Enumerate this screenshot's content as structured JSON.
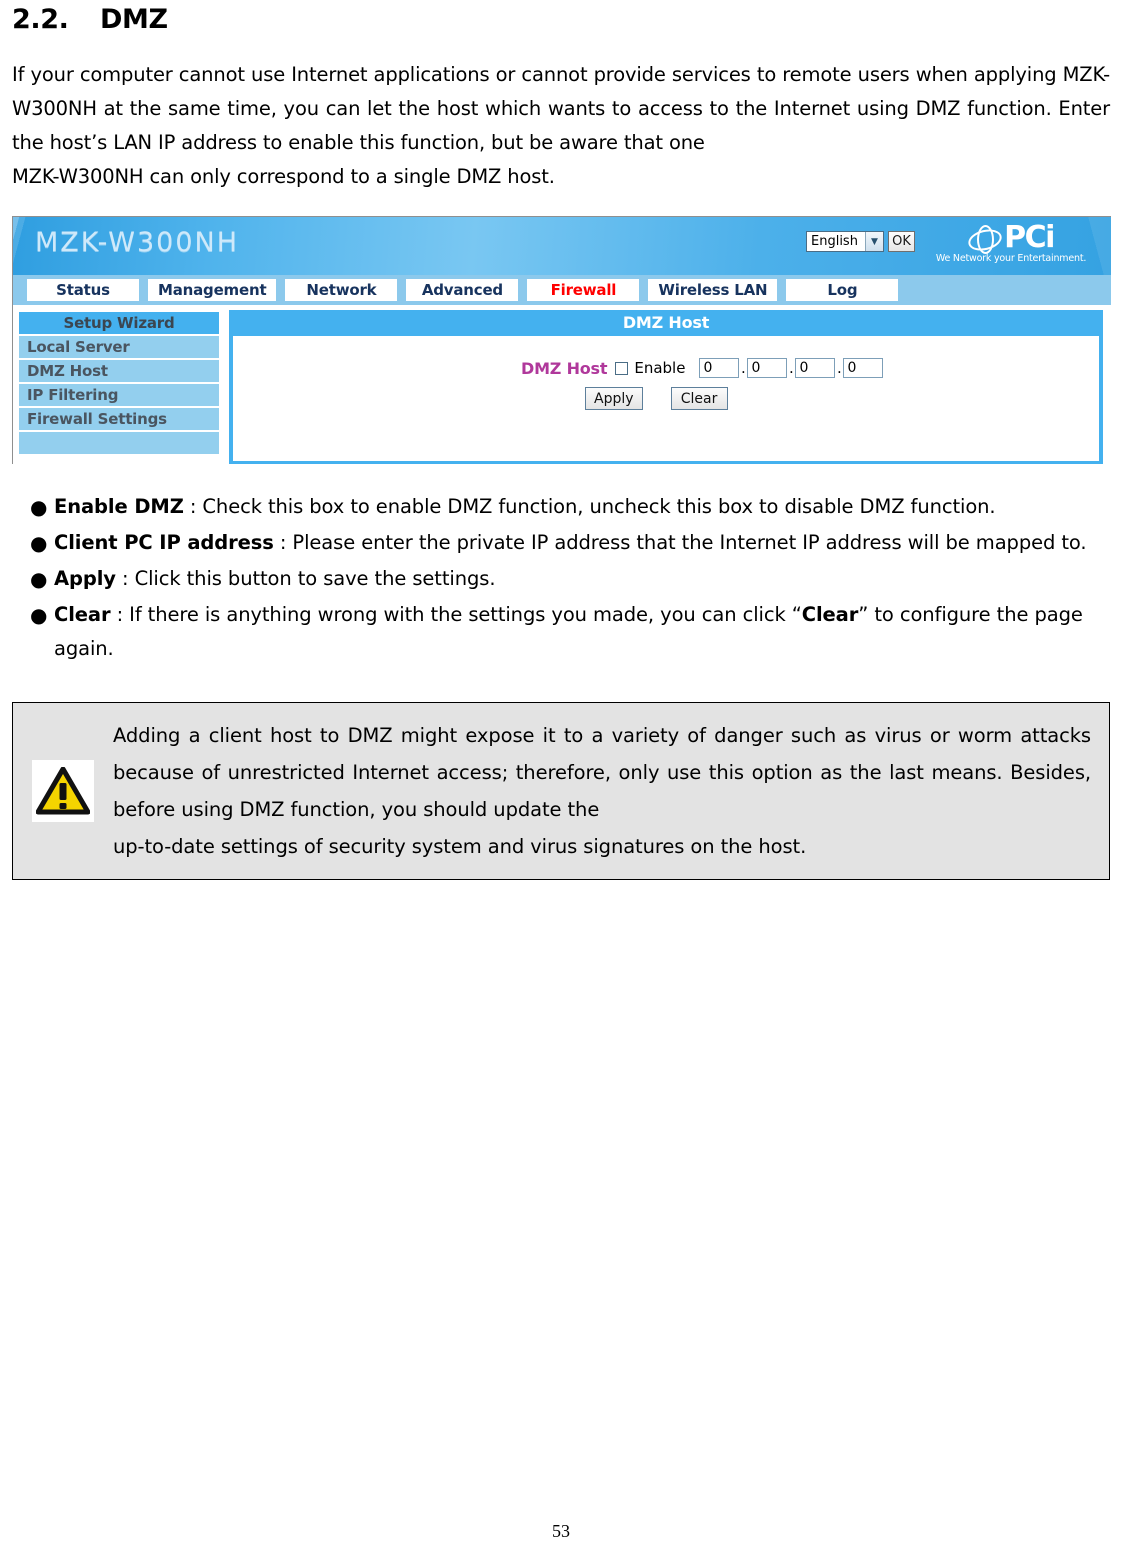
{
  "heading": {
    "number": "2.2.",
    "title": "DMZ"
  },
  "intro": {
    "line1": "If your computer cannot use Internet applications or cannot provide services to remote users when applying MZK-W300NH at the same time, you can let the host which wants to access to the Internet using DMZ function. Enter the host’s LAN IP address to enable this function, but be aware that one",
    "line2": "MZK-W300NH can only correspond to a single DMZ host."
  },
  "router_ui": {
    "model_name": "MZK-W300NH",
    "language": {
      "selected": "English",
      "arrow_icon": "chevron-down-icon",
      "ok_label": "OK"
    },
    "brand": {
      "mark_icon": "pci-globe-icon",
      "name": "PCi",
      "tagline": "We Network your Entertainment."
    },
    "nav_tabs": [
      {
        "label": "Status",
        "active": false
      },
      {
        "label": "Management",
        "active": false
      },
      {
        "label": "Network",
        "active": false
      },
      {
        "label": "Advanced",
        "active": false
      },
      {
        "label": "Firewall",
        "active": true
      },
      {
        "label": "Wireless LAN",
        "active": false
      },
      {
        "label": "Log",
        "active": false
      }
    ],
    "sidebar": [
      {
        "label": "Setup Wizard",
        "selected": true
      },
      {
        "label": "Local Server",
        "selected": false
      },
      {
        "label": "DMZ Host",
        "selected": false
      },
      {
        "label": "IP Filtering",
        "selected": false
      },
      {
        "label": "Firewall Settings",
        "selected": false
      }
    ],
    "panel": {
      "title": "DMZ Host",
      "field_label": "DMZ Host",
      "checkbox": {
        "label": "Enable",
        "checked": false
      },
      "ip_octets": [
        "0",
        "0",
        "0",
        "0"
      ],
      "separator": ".",
      "buttons": [
        {
          "label": "Apply"
        },
        {
          "label": "Clear"
        }
      ]
    }
  },
  "bullets": [
    {
      "marker": "●",
      "term": "Enable DMZ",
      "rest": " : Check this box to enable DMZ function, uncheck this box to disable DMZ function."
    },
    {
      "marker": "●",
      "term": "Client PC IP address",
      "rest": " : Please enter the private IP address that the Internet IP address will be mapped to."
    },
    {
      "marker": "●",
      "term": "Apply",
      "rest": " : Click this button to save the settings."
    },
    {
      "marker": "●",
      "term": "Clear",
      "rest_before": " : If there is anything wrong with the settings you made, you can click “",
      "emphasis": "Clear",
      "rest_after": "” to configure the page again."
    }
  ],
  "note": {
    "icon": "warning-triangle-icon",
    "body": "Adding a client host to DMZ might expose it to a variety of danger such as virus or worm attacks because of unrestricted Internet access; therefore, only use this option as the last means. Besides, before using DMZ function, you should update the",
    "body_last": "up-to-date settings of security system and virus signatures on the host."
  },
  "footer": {
    "page_number": "53"
  },
  "colors": {
    "accent_blue": "#44b1ef",
    "nav_bg": "#8cc9ec",
    "sidebar_item": "#93cfee",
    "active_tab_red": "#ff0000",
    "field_label_magenta": "#b0389b",
    "note_bg": "#e3e3e3",
    "warning_yellow": "#ffd700"
  }
}
